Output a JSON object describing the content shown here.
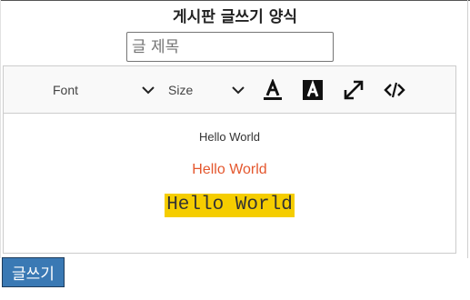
{
  "form": {
    "title": "게시판 글쓰기 양식",
    "subject_placeholder": "글 제목",
    "subject_value": ""
  },
  "toolbar": {
    "font_picker": "Font",
    "size_picker": "Size",
    "buttons": [
      "font-color-icon",
      "background-color-icon",
      "fullscreen-icon",
      "code-view-icon"
    ]
  },
  "content": {
    "lines": [
      "Hello World",
      "Hello World",
      "Hello World"
    ]
  },
  "actions": {
    "submit_label": "글쓰기"
  },
  "colors": {
    "accent": "#3a79b4",
    "line_2_text": "#e4572e",
    "line_3_highlight": "#f5cd00"
  }
}
